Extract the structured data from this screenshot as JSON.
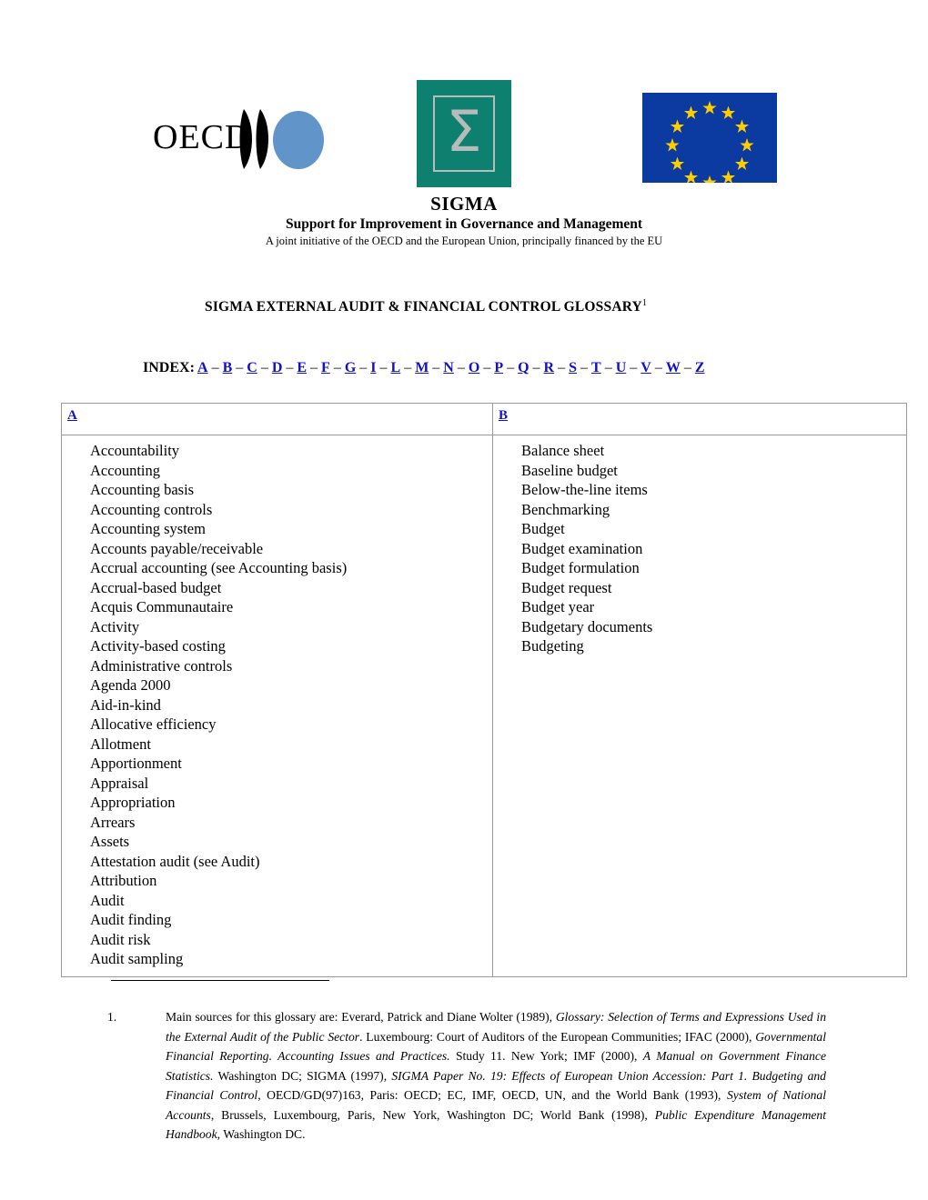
{
  "logos": {
    "oecd": {
      "name": "oecd-logo",
      "text": "OECD",
      "ellipse_color": "#6195c9"
    },
    "sigma": {
      "name": "sigma-logo",
      "glyph": "Σ",
      "background_color": "#0d8070",
      "glyph_color": "#b6bbbb"
    },
    "eu": {
      "name": "european-union-flag",
      "background_color": "#0b3ba0",
      "star_color": "#ffcc00",
      "star_count": 12
    }
  },
  "brand": {
    "title": "SIGMA",
    "subtitle": "Support for Improvement in Governance and Management",
    "note": "A joint initiative of the OECD and the European Union, principally financed by the EU"
  },
  "document": {
    "title": "SIGMA EXTERNAL AUDIT & FINANCIAL CONTROL GLOSSARY",
    "title_footnote_marker": "1"
  },
  "index": {
    "label": "INDEX:",
    "separator": "–",
    "letters": [
      "A",
      "B",
      "C",
      "D",
      "E",
      "F",
      "G",
      "I",
      "L",
      "M",
      "N",
      "O",
      "P",
      "Q",
      "R",
      "S",
      "T",
      "U",
      "V",
      "W",
      "Z"
    ]
  },
  "glossary": {
    "columns": [
      {
        "heading": "A",
        "terms": [
          "Accountability",
          "Accounting",
          "Accounting basis",
          "Accounting controls",
          "Accounting system",
          "Accounts payable/receivable",
          "Accrual accounting (see Accounting basis)",
          "Accrual-based budget",
          "Acquis Communautaire",
          "Activity",
          "Activity-based costing",
          "Administrative controls",
          "Agenda 2000",
          "Aid-in-kind",
          "Allocative efficiency",
          "Allotment",
          "Apportionment",
          "Appraisal",
          "Appropriation",
          "Arrears",
          "Assets",
          "Attestation audit (see Audit)",
          "Attribution",
          "Audit",
          "Audit finding",
          "Audit risk",
          "Audit sampling"
        ]
      },
      {
        "heading": "B",
        "terms": [
          "Balance sheet",
          "Baseline budget",
          "Below-the-line items",
          "Benchmarking",
          "Budget",
          "Budget examination",
          "Budget formulation",
          "Budget request",
          "Budget year",
          "Budgetary documents",
          "Budgeting"
        ]
      }
    ]
  },
  "footnote": {
    "number": "1.",
    "segments": [
      {
        "text": "Main sources for this glossary are: Everard, Patrick and Diane Wolter (1989), ",
        "italic": false
      },
      {
        "text": "Glossary: Selection of Terms and Expressions Used in the External Audit of the Public Sector",
        "italic": true
      },
      {
        "text": ". Luxembourg: Court of Auditors of the European Communities; IFAC (2000), ",
        "italic": false
      },
      {
        "text": "Governmental Financial Reporting. Accounting Issues and Practices.",
        "italic": true
      },
      {
        "text": " Study 11. New York; IMF (2000), ",
        "italic": false
      },
      {
        "text": "A Manual on Government Finance Statistics.",
        "italic": true
      },
      {
        "text": " Washington DC; SIGMA (1997), ",
        "italic": false
      },
      {
        "text": "SIGMA Paper No. 19: Effects of European Union Accession: Part 1. Budgeting and Financial Control",
        "italic": true
      },
      {
        "text": ", OECD/GD(97)163, Paris: OECD; EC, IMF, OECD, UN, and the World Bank (1993), ",
        "italic": false
      },
      {
        "text": "System of National Accounts",
        "italic": true
      },
      {
        "text": ", Brussels, Luxembourg, Paris, New York, Washington DC; World Bank (1998), ",
        "italic": false
      },
      {
        "text": "Public Expenditure Management Handbook",
        "italic": true
      },
      {
        "text": ", Washington DC.",
        "italic": false
      }
    ]
  }
}
